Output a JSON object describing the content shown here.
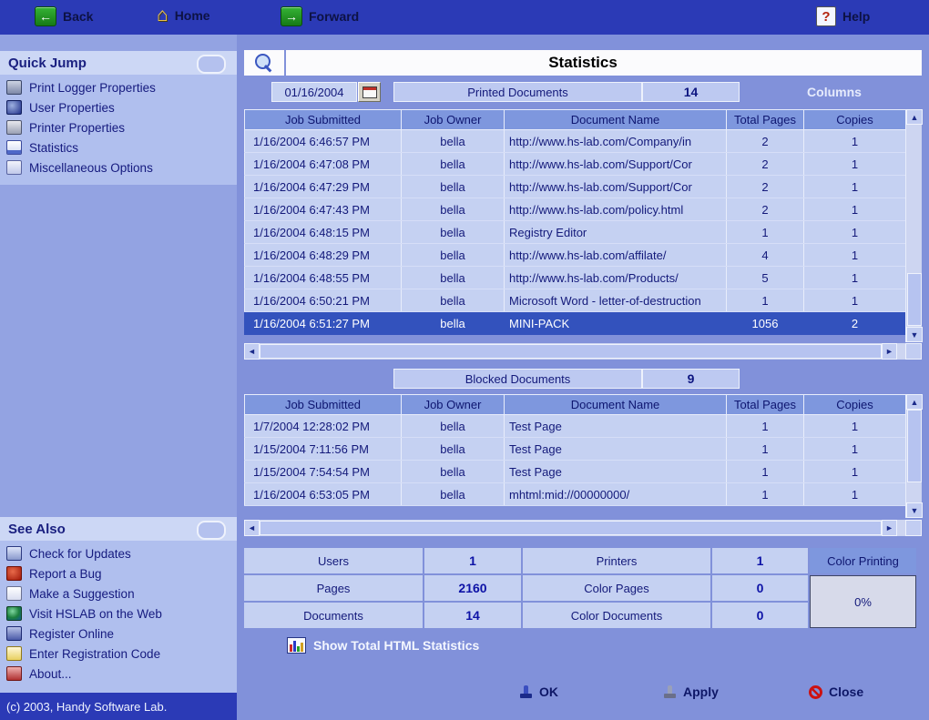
{
  "toolbar": {
    "back": "Back",
    "home": "Home",
    "forward": "Forward",
    "help": "Help"
  },
  "sidebar": {
    "quick_jump": {
      "title": "Quick Jump",
      "items": [
        {
          "icon": "logger-properties-icon",
          "label": "Print Logger Properties"
        },
        {
          "icon": "user-properties-icon",
          "label": "User Properties"
        },
        {
          "icon": "printer-properties-icon",
          "label": "Printer Properties"
        },
        {
          "icon": "statistics-icon",
          "label": "Statistics"
        },
        {
          "icon": "misc-options-icon",
          "label": "Miscellaneous Options"
        }
      ]
    },
    "see_also": {
      "title": "See Also",
      "items": [
        {
          "icon": "updates-icon",
          "label": "Check for Updates"
        },
        {
          "icon": "bug-icon",
          "label": "Report a Bug"
        },
        {
          "icon": "suggestion-icon",
          "label": "Make a Suggestion"
        },
        {
          "icon": "globe-icon",
          "label": "Visit HSLAB on the Web"
        },
        {
          "icon": "register-icon",
          "label": "Register Online"
        },
        {
          "icon": "registration-code-icon",
          "label": "Enter Registration Code"
        },
        {
          "icon": "about-icon",
          "label": "About..."
        }
      ]
    },
    "copyright": "(c) 2003, Handy Software Lab."
  },
  "main": {
    "title": "Statistics",
    "date_value": "01/16/2004",
    "columns_label": "Columns",
    "table_headers": [
      "Job Submitted",
      "Job Owner",
      "Document Name",
      "Total Pages",
      "Copies"
    ],
    "printed": {
      "label": "Printed Documents",
      "count": "14",
      "selected_index": 8,
      "rows": [
        [
          "1/16/2004 6:46:57 PM",
          "bella",
          "http://www.hs-lab.com/Company/in",
          "2",
          "1"
        ],
        [
          "1/16/2004 6:47:08 PM",
          "bella",
          "http://www.hs-lab.com/Support/Cor",
          "2",
          "1"
        ],
        [
          "1/16/2004 6:47:29 PM",
          "bella",
          "http://www.hs-lab.com/Support/Cor",
          "2",
          "1"
        ],
        [
          "1/16/2004 6:47:43 PM",
          "bella",
          "http://www.hs-lab.com/policy.html",
          "2",
          "1"
        ],
        [
          "1/16/2004 6:48:15 PM",
          "bella",
          "Registry Editor",
          "1",
          "1"
        ],
        [
          "1/16/2004 6:48:29 PM",
          "bella",
          "http://www.hs-lab.com/affilate/",
          "4",
          "1"
        ],
        [
          "1/16/2004 6:48:55 PM",
          "bella",
          "http://www.hs-lab.com/Products/",
          "5",
          "1"
        ],
        [
          "1/16/2004 6:50:21 PM",
          "bella",
          "Microsoft Word - letter-of-destruction",
          "1",
          "1"
        ],
        [
          "1/16/2004 6:51:27 PM",
          "bella",
          "MINI-PACK",
          "1056",
          "2"
        ]
      ]
    },
    "blocked": {
      "label": "Blocked Documents",
      "count": "9",
      "rows": [
        [
          "1/7/2004 12:28:02 PM",
          "bella",
          "Test Page",
          "1",
          "1"
        ],
        [
          "1/15/2004 7:11:56 PM",
          "bella",
          "Test Page",
          "1",
          "1"
        ],
        [
          "1/15/2004 7:54:54 PM",
          "bella",
          "Test Page",
          "1",
          "1"
        ],
        [
          "1/16/2004 6:53:05 PM",
          "bella",
          "mhtml:mid://00000000/",
          "1",
          "1"
        ]
      ]
    },
    "summary": {
      "users_label": "Users",
      "users_value": "1",
      "printers_label": "Printers",
      "printers_value": "1",
      "pages_label": "Pages",
      "pages_value": "2160",
      "color_pages_label": "Color Pages",
      "color_pages_value": "0",
      "documents_label": "Documents",
      "documents_value": "14",
      "color_documents_label": "Color Documents",
      "color_documents_value": "0",
      "color_printing_label": "Color Printing",
      "color_printing_value": "0%"
    },
    "show_total": "Show Total HTML Statistics",
    "buttons": {
      "ok": "OK",
      "apply": "Apply",
      "close": "Close"
    }
  }
}
